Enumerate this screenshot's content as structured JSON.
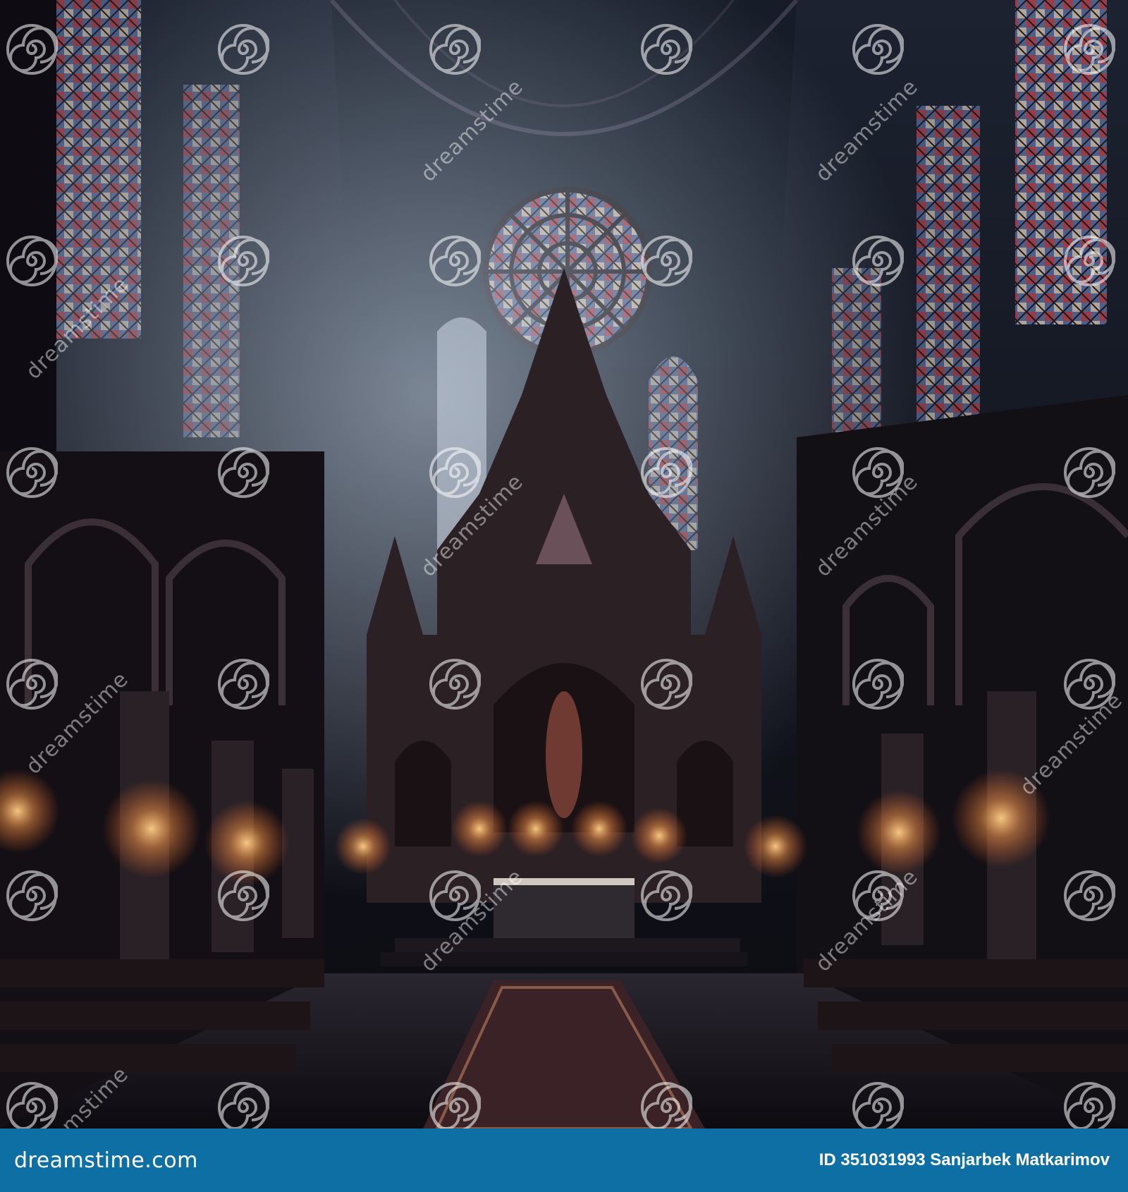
{
  "image": {
    "subject": "dreamstime.com",
    "palette": {
      "stone": "#1a1620",
      "glow": "#ff9a4a",
      "glass_red": "#c8424a",
      "glass_blue": "#4a6fb0",
      "light": "#cfe0f2"
    }
  },
  "watermark": {
    "text": "dreamstime",
    "icon": "spiral-icon"
  },
  "footer": {
    "logo": "dreamstime.com",
    "id_label": "ID 351031993",
    "author": "Sanjarbek Matkarimov",
    "bg_color": "#0e6fa5"
  }
}
